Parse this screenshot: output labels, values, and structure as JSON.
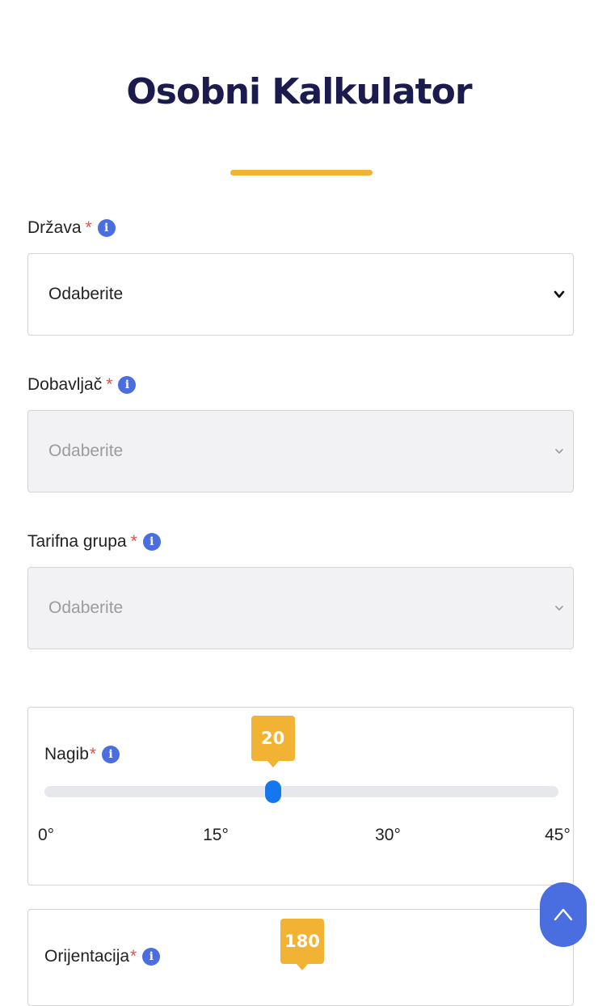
{
  "page_title": "Osobni Kalkulator",
  "colors": {
    "title": "#1c1b4d",
    "accent": "#f2b233",
    "info": "#4a6ee0",
    "slider_thumb": "#1577ee"
  },
  "fields": [
    {
      "label": "Država",
      "required_mark": "*",
      "info_icon": "info-icon",
      "value": "Odaberite",
      "disabled": false
    },
    {
      "label": "Dobavljač",
      "required_mark": "*",
      "info_icon": "info-icon",
      "value": "Odaberite",
      "disabled": true
    },
    {
      "label": "Tarifna grupa",
      "required_mark": "*",
      "info_icon": "info-icon",
      "value": "Odaberite",
      "disabled": true
    }
  ],
  "sliders": [
    {
      "label": "Nagib",
      "required_mark": "*",
      "value": "20",
      "value_num": 20,
      "min": 0,
      "max": 45,
      "ticks": [
        "0°",
        "15°",
        "30°",
        "45°"
      ]
    },
    {
      "label": "Orijentacija",
      "required_mark": "*",
      "value": "180"
    }
  ],
  "scroll_top_icon": "chevron-up-icon"
}
